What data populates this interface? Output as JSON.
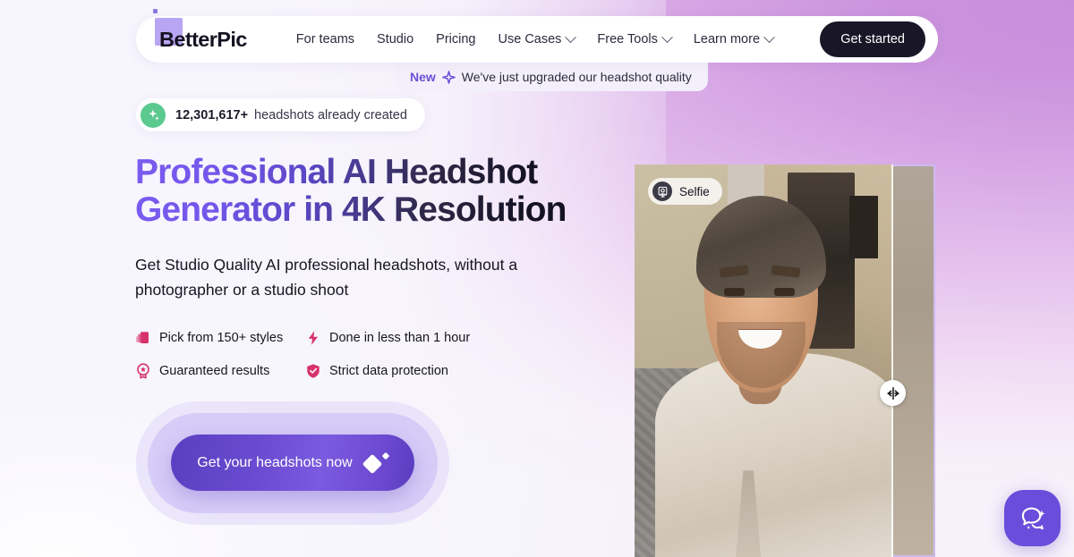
{
  "brand": {
    "name": "BetterPic",
    "logo_square_color": "#b9a6f2"
  },
  "nav": {
    "links": [
      {
        "label": "For teams",
        "has_chevron": false,
        "icon": ""
      },
      {
        "label": "Studio",
        "has_chevron": false,
        "icon": ""
      },
      {
        "label": "Pricing",
        "has_chevron": false,
        "icon": ""
      },
      {
        "label": "Use Cases",
        "has_chevron": true,
        "icon": "chevron-down-icon"
      },
      {
        "label": "Free Tools",
        "has_chevron": true,
        "icon": "chevron-down-icon"
      },
      {
        "label": "Learn more",
        "has_chevron": true,
        "icon": "chevron-down-icon"
      }
    ],
    "cta_label": "Get started"
  },
  "announcement": {
    "badge": "New",
    "icon": "sparkle-icon",
    "text": "We've just upgraded our headshot quality"
  },
  "counter": {
    "icon": "sparkles-icon",
    "icon_bg": "#5cc98f",
    "number": "12,301,617+",
    "text": "headshots already created"
  },
  "hero": {
    "headline_line1": "Professional AI Headshot",
    "headline_line2": "Generator in 4K Resolution",
    "headline_gradient_start": "#7b5cf0",
    "headline_gradient_end": "#141224",
    "subheadline": "Get Studio Quality AI professional headshots, without a photographer or a studio shoot",
    "features": [
      {
        "icon": "style-cards-icon",
        "label": "Pick from 150+ styles",
        "color": "#d6336c"
      },
      {
        "icon": "lightning-bolt-icon",
        "label": "Done in less than 1 hour",
        "color": "#d6336c"
      },
      {
        "icon": "award-badge-icon",
        "label": "Guaranteed results",
        "color": "#d6336c"
      },
      {
        "icon": "shield-check-icon",
        "label": "Strict data protection",
        "color": "#d6336c"
      }
    ],
    "cta": {
      "label": "Get your headshots now",
      "icon": "diamond-sparkle-icon",
      "color": "#6a4bd0"
    }
  },
  "comparison": {
    "badge_label": "Selfie",
    "badge_icon": "selfie-photo-icon",
    "handle_icon": "left-right-arrows-icon"
  },
  "chat": {
    "icon": "chat-bubble-sparkle-icon",
    "color": "#6a4ddb"
  }
}
